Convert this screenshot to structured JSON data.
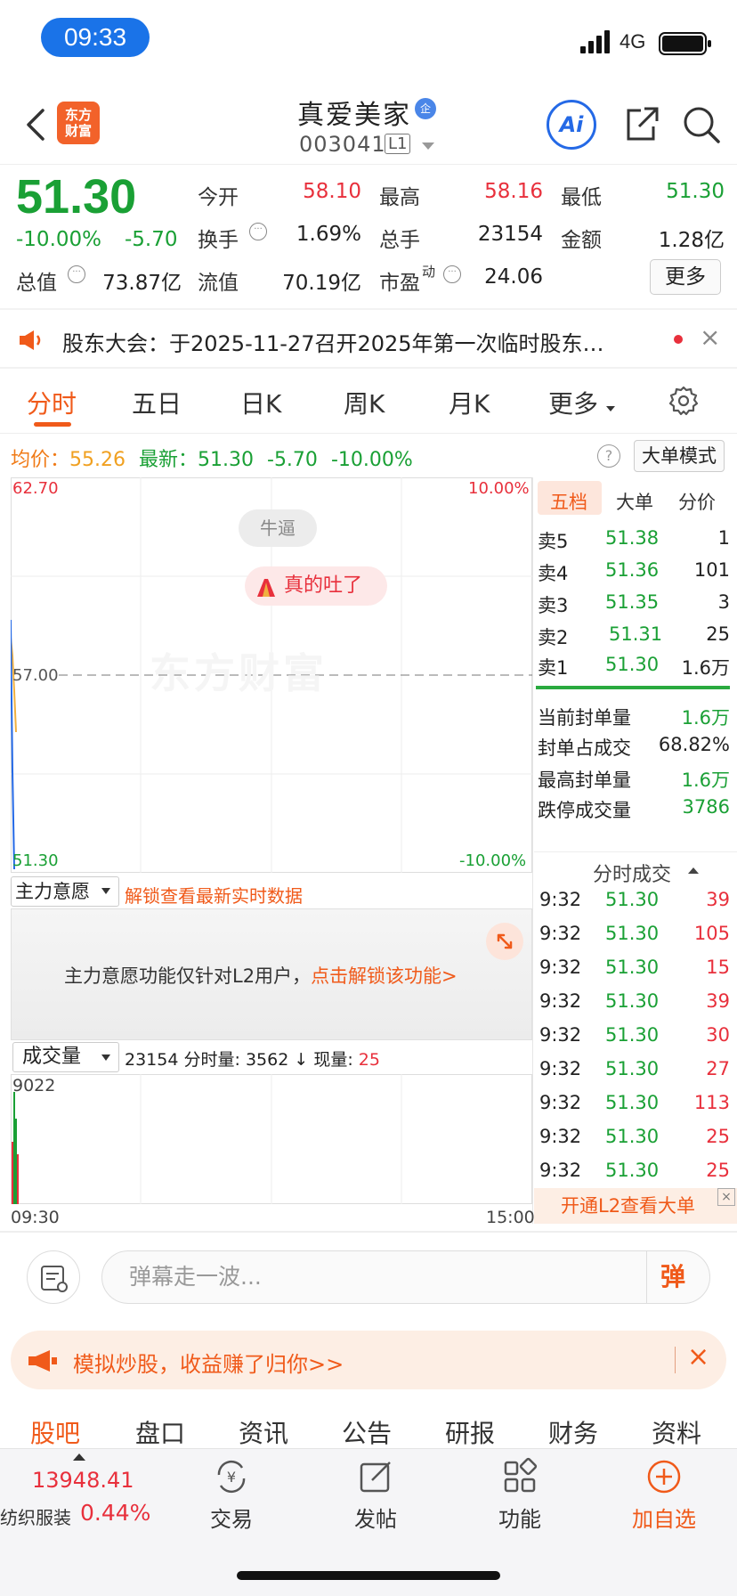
{
  "status_bar": {
    "time": "09:33",
    "network": "4G"
  },
  "header": {
    "logo_text": "东方财富",
    "stock_name": "真爱美家",
    "badge": "企",
    "code": "003041",
    "level": "L1",
    "ai_label": "Ai"
  },
  "quote": {
    "price": "51.30",
    "change_pct": "-10.00%",
    "change_amt": "-5.70",
    "fields": [
      {
        "label": "今开",
        "value": "58.10",
        "color": "red"
      },
      {
        "label": "最高",
        "value": "58.16",
        "color": "red"
      },
      {
        "label": "最低",
        "value": "51.30",
        "color": "green"
      },
      {
        "label": "换手",
        "value": "1.69%",
        "color": "normal"
      },
      {
        "label": "总手",
        "value": "23154",
        "color": "normal"
      },
      {
        "label": "金额",
        "value": "1.28亿",
        "color": "normal"
      },
      {
        "label": "总值",
        "value": "73.87亿",
        "color": "normal"
      },
      {
        "label": "流值",
        "value": "70.19亿",
        "color": "normal"
      },
      {
        "label": "市盈",
        "label_sup": "动",
        "value": "24.06",
        "color": "normal"
      }
    ],
    "more_label": "更多"
  },
  "notice": {
    "text": "股东大会：于2025-11-27召开2025年第一次临时股东…",
    "close": "×"
  },
  "tabs": [
    "分时",
    "五日",
    "日K",
    "周K",
    "月K",
    "更多"
  ],
  "avg_line": {
    "avg_label": "均价：",
    "avg_value": "55.26",
    "latest_label": "最新：",
    "latest_value": "51.30",
    "chg": "-5.70",
    "pct": "-10.00%"
  },
  "big_mode_label": "大单模式",
  "chart": {
    "y_top": "62.70",
    "y_mid": "57.00",
    "y_bottom": "51.30",
    "pct_top": "10.00%",
    "pct_bottom": "-10.00%",
    "watermark": "东方财富",
    "danmu_1": "牛逼",
    "danmu_2": "真的吐了"
  },
  "orderbook": {
    "tabs": [
      "五档",
      "大单",
      "分价"
    ],
    "asks": [
      {
        "label": "卖5",
        "price": "51.38",
        "vol": "1"
      },
      {
        "label": "卖4",
        "price": "51.36",
        "vol": "101"
      },
      {
        "label": "卖3",
        "price": "51.35",
        "vol": "3"
      },
      {
        "label": "卖2",
        "price": "51.31",
        "vol": "25"
      },
      {
        "label": "卖1",
        "price": "51.30",
        "vol": "1.6万"
      }
    ],
    "stats": [
      {
        "label": "当前封单量",
        "value": "1.6万",
        "color": "green"
      },
      {
        "label": "封单占成交",
        "value": "68.82%",
        "color": "normal"
      },
      {
        "label": "最高封单量",
        "value": "1.6万",
        "color": "green"
      },
      {
        "label": "跌停成交量",
        "value": "3786",
        "color": "green"
      }
    ],
    "trades_title": "分时成交",
    "trades": [
      {
        "time": "9:32",
        "price": "51.30",
        "vol": "39"
      },
      {
        "time": "9:32",
        "price": "51.30",
        "vol": "105"
      },
      {
        "time": "9:32",
        "price": "51.30",
        "vol": "15"
      },
      {
        "time": "9:32",
        "price": "51.30",
        "vol": "39"
      },
      {
        "time": "9:32",
        "price": "51.30",
        "vol": "30"
      },
      {
        "time": "9:32",
        "price": "51.30",
        "vol": "27"
      },
      {
        "time": "9:32",
        "price": "51.30",
        "vol": "113"
      },
      {
        "time": "9:32",
        "price": "51.30",
        "vol": "25"
      },
      {
        "time": "9:32",
        "price": "51.30",
        "vol": "25"
      }
    ],
    "l2_banner": "开通L2查看大单"
  },
  "main_force": {
    "select_label": "主力意愿",
    "unlock_link": "解锁查看最新实时数据",
    "msg": "主力意愿功能仅针对L2用户，",
    "msg_link": "点击解锁该功能>"
  },
  "volume": {
    "select_label": "成交量",
    "total": "23154",
    "minute_label": "分时量:",
    "minute_value": "3562",
    "arrow": "↓",
    "now_label": "现量:",
    "now_value": "25",
    "y_max": "9022",
    "t_start": "09:30",
    "t_end": "15:00"
  },
  "danmu_input": {
    "placeholder": "弹幕走一波...",
    "button": "弹"
  },
  "sim_banner": {
    "text": "模拟炒股，收益赚了归你>>",
    "close": "×"
  },
  "section_tabs": [
    "股吧",
    "盘口",
    "资讯",
    "公告",
    "研报",
    "财务",
    "资料"
  ],
  "bottom_bar": {
    "index_value": "13948.41",
    "index_name": "纺织服装",
    "index_pct": "0.44%",
    "items": [
      {
        "icon": "trade-icon",
        "label": "交易"
      },
      {
        "icon": "post-icon",
        "label": "发帖"
      },
      {
        "icon": "function-icon",
        "label": "功能"
      },
      {
        "icon": "add-watchlist-icon",
        "label": "加自选"
      }
    ]
  },
  "colors": {
    "up": "#e8303c",
    "down": "#1aa035",
    "accent": "#f05a1a",
    "brand_blue": "#2469e6"
  }
}
